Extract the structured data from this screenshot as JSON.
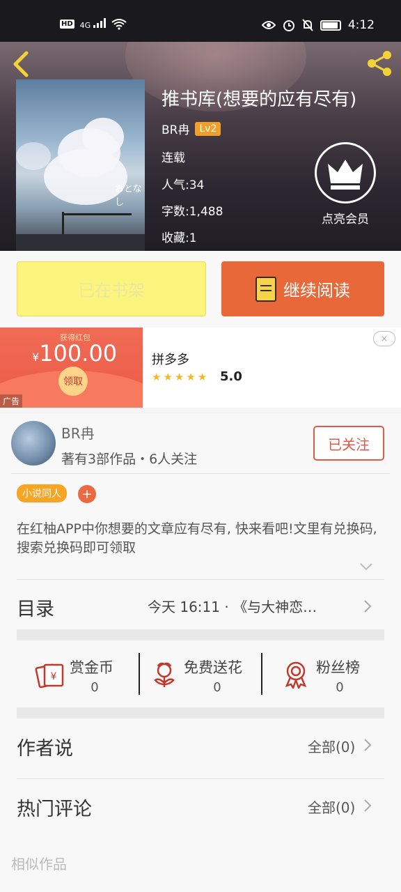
{
  "status_bar": {
    "time": "4:12",
    "network": "4G",
    "hd": "HD"
  },
  "book": {
    "title": "推书库(想要的应有尽有)",
    "author": "BR冉",
    "level": "Lv2",
    "status": "连载",
    "popularity": "人气:34",
    "word_count": "字数:1,488",
    "favorites": "收藏:1",
    "cover_text": "おとなし"
  },
  "vip": {
    "label": "点亮会员"
  },
  "actions": {
    "on_shelf": "已在书架",
    "continue_read": "继续阅读"
  },
  "ad": {
    "got_label": "获得红包",
    "currency": "¥",
    "amount": "100.00",
    "take_label": "领取",
    "ad_tag": "广告",
    "advertiser": "拼多多",
    "rating": "5.0",
    "close": "×"
  },
  "author_panel": {
    "name": "BR冉",
    "stats": "著有3部作品・6人关注",
    "follow_label": "已关注"
  },
  "tags": {
    "tag1": "小说同人",
    "add": "+"
  },
  "description": "在红柚APP中你想要的文章应有尽有, 快来看吧!文里有兑换码, 搜索兑换码即可领取",
  "toc": {
    "label": "目录",
    "latest": "今天  16:11  ·  《与大神恋…"
  },
  "stats": [
    {
      "label": "赏金币",
      "value": "0"
    },
    {
      "label": "免费送花",
      "value": "0"
    },
    {
      "label": "粉丝榜",
      "value": "0"
    }
  ],
  "author_says": {
    "label": "作者说",
    "all": "全部(0)"
  },
  "hot_comments": {
    "label": "热门评论",
    "all": "全部(0)"
  },
  "similar": {
    "label": "相似作品"
  },
  "colors": {
    "accent": "#e8683a",
    "shelf": "#fbf57e",
    "tag": "#f6a524",
    "follow": "#e05a45"
  }
}
